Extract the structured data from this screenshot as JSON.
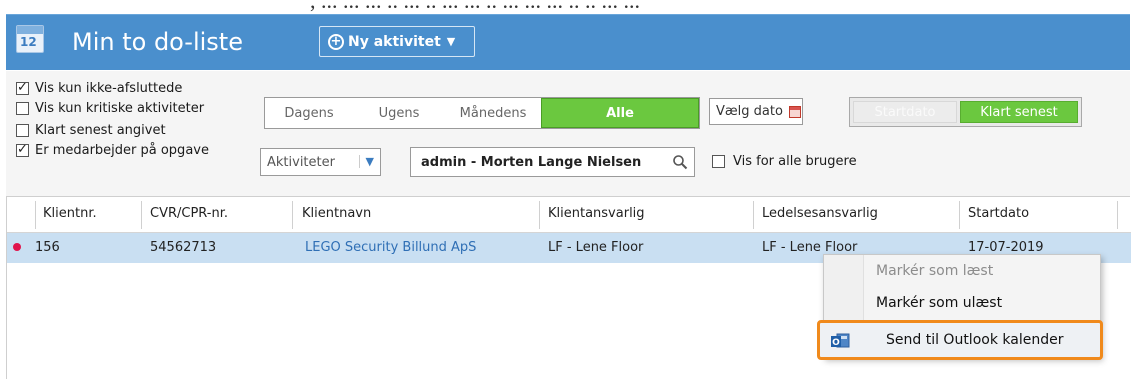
{
  "caption_fragment": ", ... ... ... .. ... .. ... ... .. ... ... ... .. .. ... ...",
  "header": {
    "app_icon_number": "12",
    "title": "Min to do-liste",
    "new_button_label": "Ny aktivitet",
    "accent_color": "#4a8fcd"
  },
  "filters": {
    "checkboxes": [
      {
        "label": "Vis kun ikke-afsluttede",
        "checked": true
      },
      {
        "label": "Vis kun kritiske aktiviteter",
        "checked": false
      },
      {
        "label": "Klart senest angivet",
        "checked": false
      },
      {
        "label": "Er medarbejder på opgave",
        "checked": true
      }
    ],
    "period_tabs": [
      "Dagens",
      "Ugens",
      "Månedens",
      "Alle"
    ],
    "period_selected": "Alle",
    "date_button_label": "Vælg dato",
    "date_toggle": [
      "Startdato",
      "Klart senest"
    ],
    "date_toggle_selected": "Klart senest",
    "type_select_value": "Aktiviteter",
    "user_value": "admin - Morten Lange Nielsen",
    "all_users_label": "Vis for alle brugere",
    "all_users_checked": false,
    "selected_color": "#6bc83f"
  },
  "table": {
    "columns": [
      "Klientnr.",
      "CVR/CPR-nr.",
      "Klientnavn",
      "Klientansvarlig",
      "Ledelsesansvarlig",
      "Startdato"
    ],
    "rows": [
      {
        "klientnr": "156",
        "cvr": "54562713",
        "klientnavn": "LEGO Security Billund ApS",
        "klientansvarlig": "LF - Lene Floor",
        "ledelsesansvarlig": "LF - Lene Floor",
        "startdato": "17-07-2019"
      }
    ]
  },
  "context_menu": {
    "items": [
      {
        "label": "Markér som læst",
        "enabled": false
      },
      {
        "label": "Markér som ulæst",
        "enabled": true
      },
      {
        "label": "Send til Outlook kalender",
        "enabled": true,
        "icon": "outlook-icon",
        "highlighted": true
      }
    ],
    "highlight_color": "#f08a1c"
  }
}
